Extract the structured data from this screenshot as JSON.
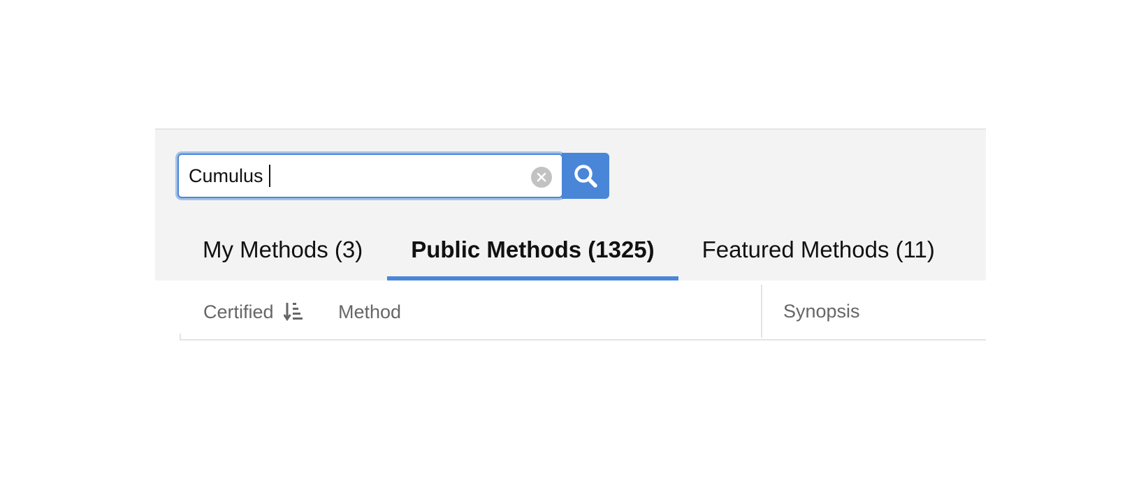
{
  "search": {
    "value": "Cumulus",
    "clear_icon": "clear-circle-icon",
    "button_icon": "search-icon"
  },
  "tabs": [
    {
      "label": "My Methods (3)",
      "active": false
    },
    {
      "label": "Public Methods (1325)",
      "active": true
    },
    {
      "label": "Featured Methods (11)",
      "active": false
    }
  ],
  "table": {
    "columns": [
      {
        "label": "Certified",
        "icon": "sort-ascending-icon"
      },
      {
        "label": "Method"
      },
      {
        "label": "Synopsis"
      }
    ]
  },
  "colors": {
    "accent": "#4a86d8",
    "panel_bg": "#f3f3f3",
    "header_text": "#666666"
  }
}
